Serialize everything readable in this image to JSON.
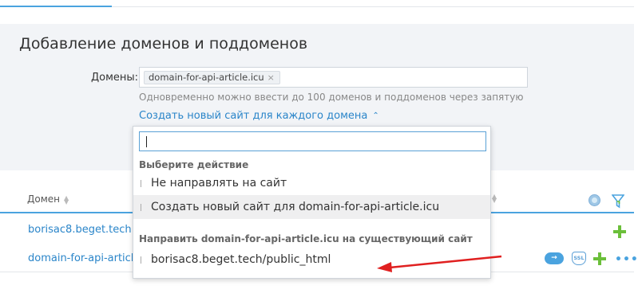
{
  "page": {
    "title": "Добавление доменов и поддоменов"
  },
  "form": {
    "domains_label": "Домены:",
    "domain_tags": [
      {
        "label": "domain-for-api-article.icu",
        "remove_glyph": "×"
      }
    ],
    "hint": "Одновременно можно ввести до 100 доменов и поддоменов через запятую",
    "create_site_link": "Создать новый сайт для каждого домена",
    "create_site_chevron": "⌃"
  },
  "dropdown": {
    "search_value": "",
    "groups": [
      {
        "label": "Выберите действие",
        "options": [
          {
            "label": "Не направлять на сайт",
            "highlighted": false
          },
          {
            "label": "Создать новый сайт для domain-for-api-article.icu",
            "highlighted": true
          }
        ]
      },
      {
        "label": "Направить domain-for-api-article.icu на существующий сайт",
        "options": [
          {
            "label": "borisac8.beget.tech/public_html",
            "highlighted": false
          }
        ]
      }
    ]
  },
  "table": {
    "columns": [
      {
        "label": "Домен"
      }
    ],
    "rows": [
      {
        "domain": "borisac8.beget.tech"
      },
      {
        "domain": "domain-for-api-article.icu"
      }
    ],
    "icons": {
      "redirect": "→",
      "ssl": "SSL",
      "more": "•••"
    }
  },
  "colors": {
    "accent": "#4aa3df",
    "link": "#2a85c9",
    "add": "#6bbf3a",
    "annotation_arrow": "#e02020",
    "panel_bg": "#f2f4f7"
  }
}
